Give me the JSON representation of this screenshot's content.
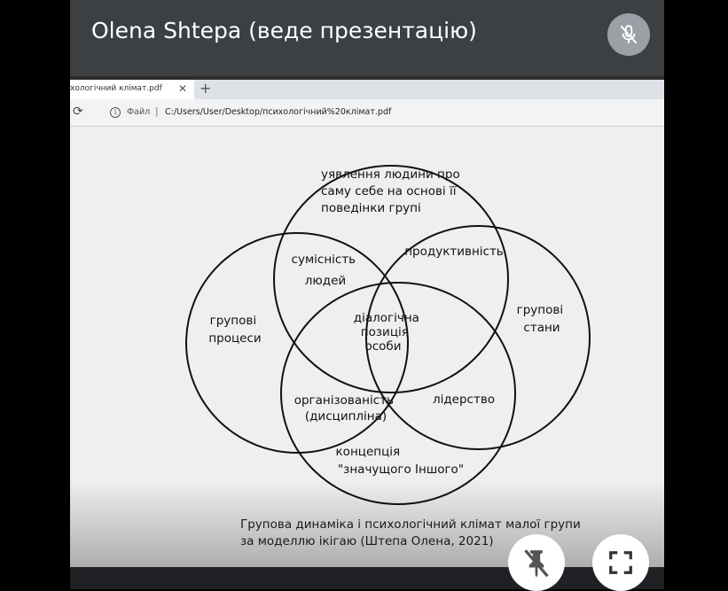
{
  "presenter": {
    "label": "Olena Shtepa (веде презентацію)"
  },
  "browser": {
    "tab_title": "хологічний клімат.pdf",
    "tab_close": "✕",
    "new_tab": "+",
    "reload": "⟳",
    "info": "i",
    "file_label": "Файл",
    "separator": "|",
    "url": "C:/Users/User/Desktop/психологічний%20клімат.pdf"
  },
  "diagram": {
    "labels": {
      "top_1": "уявлення людини про",
      "top_2": "саму себе на основі її",
      "top_3": "поведінки групі",
      "left_1": "групові",
      "left_2": "процеси",
      "right_1": "групові",
      "right_2": "стани",
      "bottom_1": "концепція",
      "bottom_2": "\"значущого Іншого\"",
      "compat_1": "сумісність",
      "compat_2": "людей",
      "productivity": "продуктивність",
      "org_1": "організованість",
      "org_2": "(дисципліна)",
      "leadership": "лідерство",
      "center_1": "діалогічна",
      "center_2": "позиція",
      "center_3": "особи"
    }
  },
  "caption": {
    "line1": "Групова динаміка і психологічний клімат малої групи",
    "line2": "за моделлю ікігаю (Штепа Олена, 2021)"
  },
  "colors": {
    "tile_bg": "#3c4043",
    "mic_button": "#9aa0a6",
    "page_bg": "#efefed",
    "ink": "#111111"
  },
  "icons": {
    "mic": "mic-off-icon",
    "unpin": "pin-off-icon",
    "fullscreen": "fullscreen-icon"
  }
}
